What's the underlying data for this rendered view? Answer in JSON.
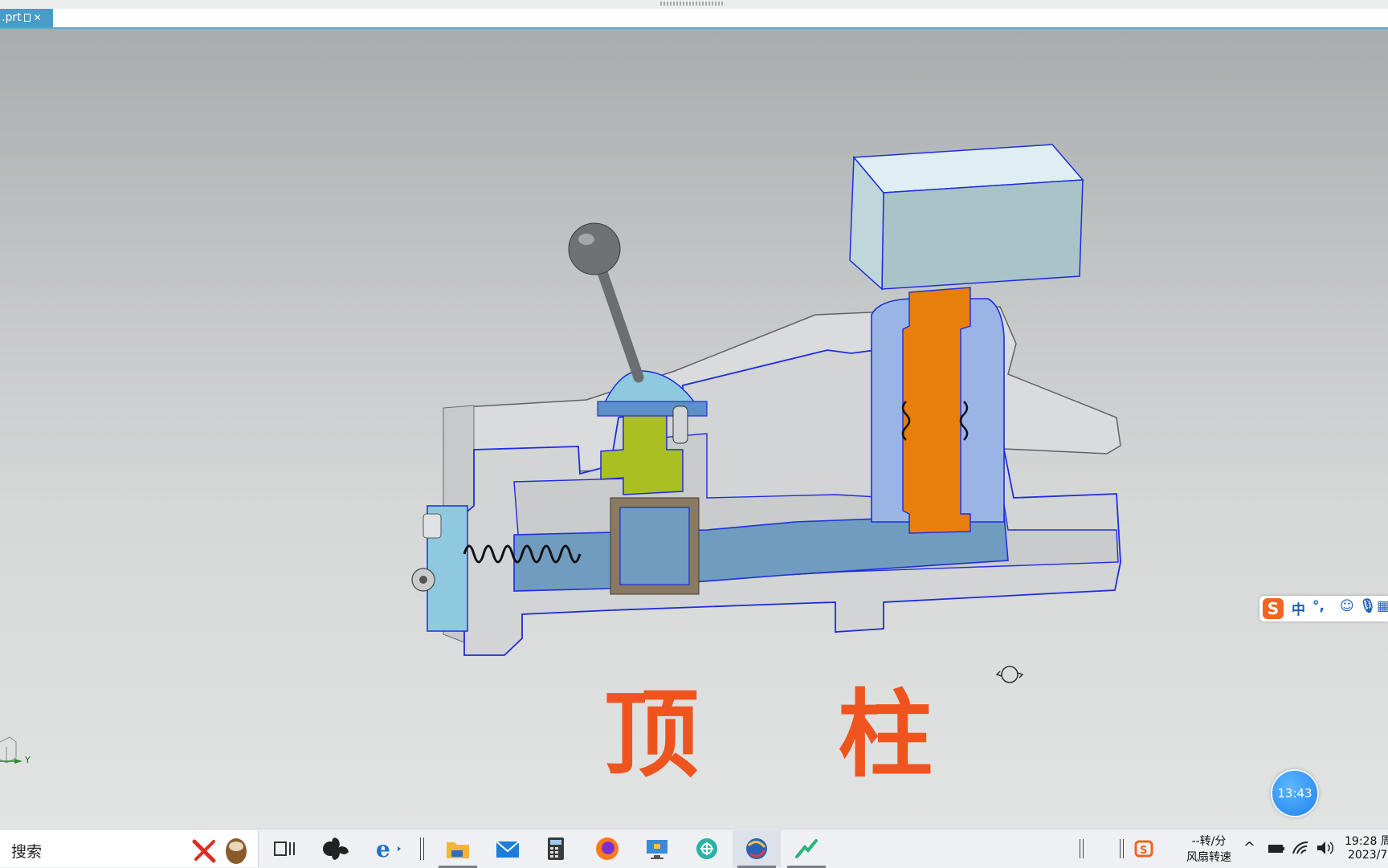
{
  "window": {
    "tab_label": ".prt"
  },
  "viewport": {
    "caption": "顶 柱",
    "axis_label": "Y",
    "timer": "13:43",
    "colors": {
      "caption": "#f0541e",
      "plunger": "#e87e0c",
      "body_section": "#6f9cbf"
    }
  },
  "ime_toolbar": {
    "logo": "S",
    "mode": "中",
    "punct": "°,"
  },
  "taskbar": {
    "search_label": "搜索",
    "fan_speed": "--转/分",
    "fan_speed_label": "风扇转速",
    "clock_time": "19:28 周",
    "clock_date": "2023/7",
    "icons": [
      "task-view-icon",
      "fan-icon",
      "edge-browser-icon",
      "file-explorer-icon",
      "mail-icon",
      "calculator-icon",
      "firefox-icon",
      "remote-desktop-icon",
      "network-icon",
      "cad-app-icon",
      "pen-app-icon",
      "sogou-ime-icon"
    ]
  }
}
